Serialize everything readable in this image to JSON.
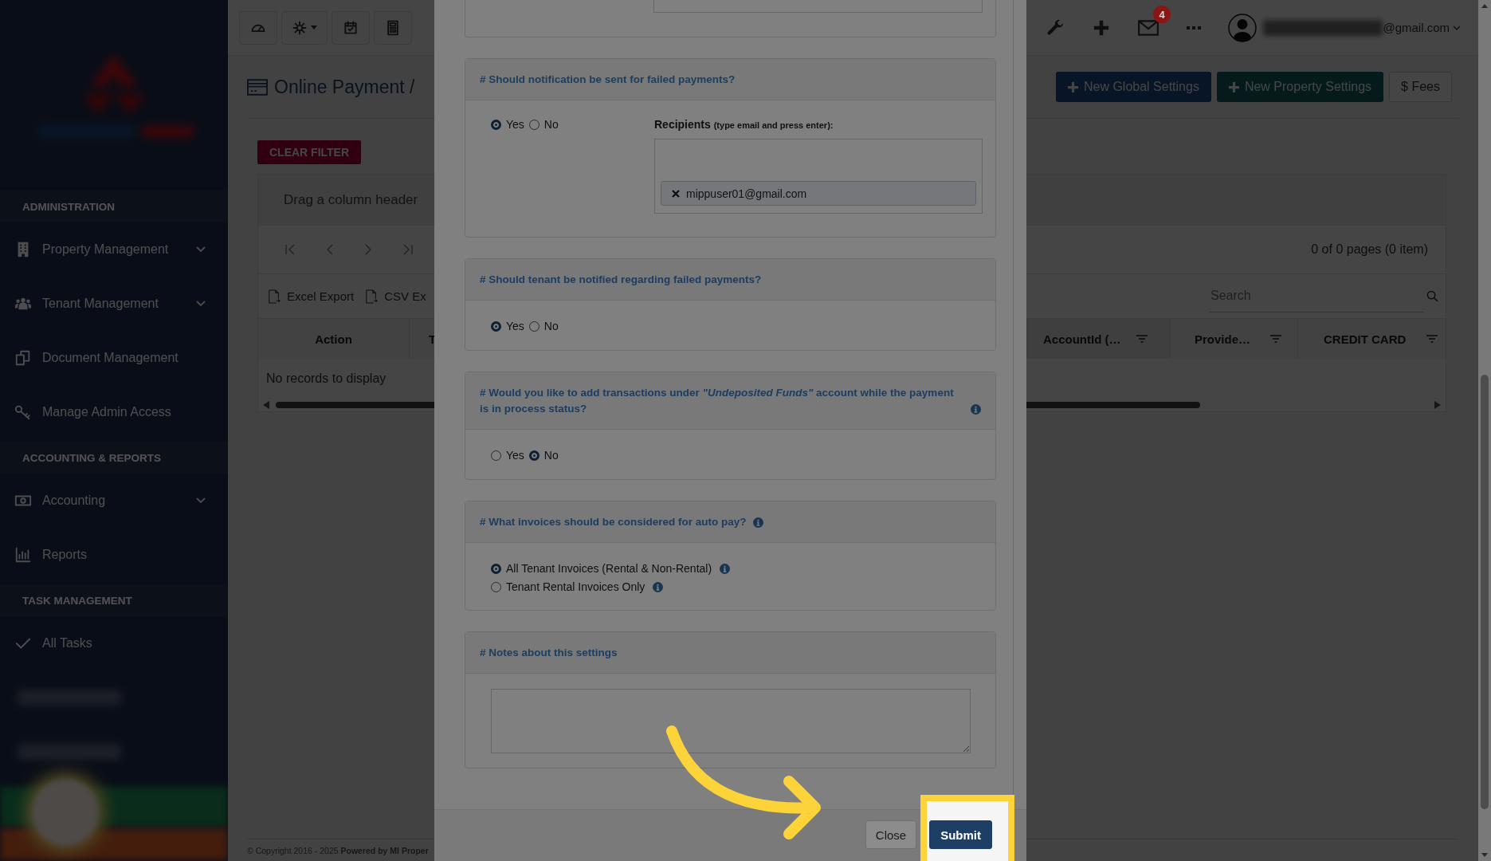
{
  "sidebar": {
    "sections": [
      {
        "title": "ADMINISTRATION",
        "items": [
          {
            "label": "Property Management",
            "expandable": true
          },
          {
            "label": "Tenant Management",
            "expandable": true
          },
          {
            "label": "Document Management",
            "expandable": false
          },
          {
            "label": "Manage Admin Access",
            "expandable": false
          }
        ]
      },
      {
        "title": "ACCOUNTING & REPORTS",
        "items": [
          {
            "label": "Accounting",
            "expandable": true
          },
          {
            "label": "Reports",
            "expandable": false
          }
        ]
      },
      {
        "title": "TASK MANAGEMENT",
        "items": [
          {
            "label": "All Tasks",
            "expandable": false
          }
        ]
      }
    ]
  },
  "header": {
    "mail_badge": "4",
    "user_email": "@gmail.com"
  },
  "page": {
    "title": "Online Payment /",
    "actions": [
      {
        "label": "New Global Settings",
        "kind": "primary"
      },
      {
        "label": "New Property Settings",
        "kind": "secondary"
      },
      {
        "label": "$ Fees",
        "kind": "outline"
      }
    ]
  },
  "grid": {
    "clear_filter": "CLEAR FILTER",
    "group_hint": "Drag a column header",
    "pager_info": "0 of 0 pages (0 item)",
    "exports": [
      "Excel Export",
      "CSV Ex"
    ],
    "search": {
      "placeholder": "Search"
    },
    "columns": [
      {
        "label": "Action",
        "filterable": false
      },
      {
        "label": "T"
      },
      {
        "label": "AccountId (…",
        "filterable": true
      },
      {
        "label": "Provide…",
        "filterable": true
      },
      {
        "label": "CREDIT CARD",
        "filterable": true
      }
    ],
    "empty_text": "No records to display"
  },
  "footer": "© Copyright 2016 - 2025 **Powered by MI Proper**",
  "modal": {
    "sections": [
      {
        "kind": "yes_no_recipients",
        "question": "# Should notification be sent for failed payments?",
        "options": [
          {
            "label": "Yes",
            "selected": true
          },
          {
            "label": "No",
            "selected": false
          }
        ],
        "recipients_label": "Recipients",
        "recipients_hint": "(type email and press enter):",
        "recipients": [
          "mippuser01@gmail.com"
        ]
      },
      {
        "kind": "yes_no",
        "question": "# Should tenant be notified regarding failed payments?",
        "options": [
          {
            "label": "Yes",
            "selected": true
          },
          {
            "label": "No",
            "selected": false
          }
        ]
      },
      {
        "kind": "yes_no",
        "question": "# Would you like to add transactions under *\"Undeposited Funds\"* account while the payment is in process status?",
        "info": true,
        "options": [
          {
            "label": "Yes",
            "selected": false
          },
          {
            "label": "No",
            "selected": true
          }
        ]
      },
      {
        "kind": "choices",
        "question": "# What invoices should be considered for auto pay?",
        "info": true,
        "options": [
          {
            "label": "All Tenant Invoices (Rental & Non-Rental)",
            "selected": true,
            "info": true
          },
          {
            "label": "Tenant Rental Invoices Only",
            "selected": false,
            "info": true
          }
        ]
      },
      {
        "kind": "notes",
        "question": "# Notes about this settings"
      }
    ],
    "buttons": [
      {
        "label": "Close",
        "kind": "default"
      },
      {
        "label": "Submit",
        "kind": "primary",
        "highlighted": true
      }
    ]
  }
}
